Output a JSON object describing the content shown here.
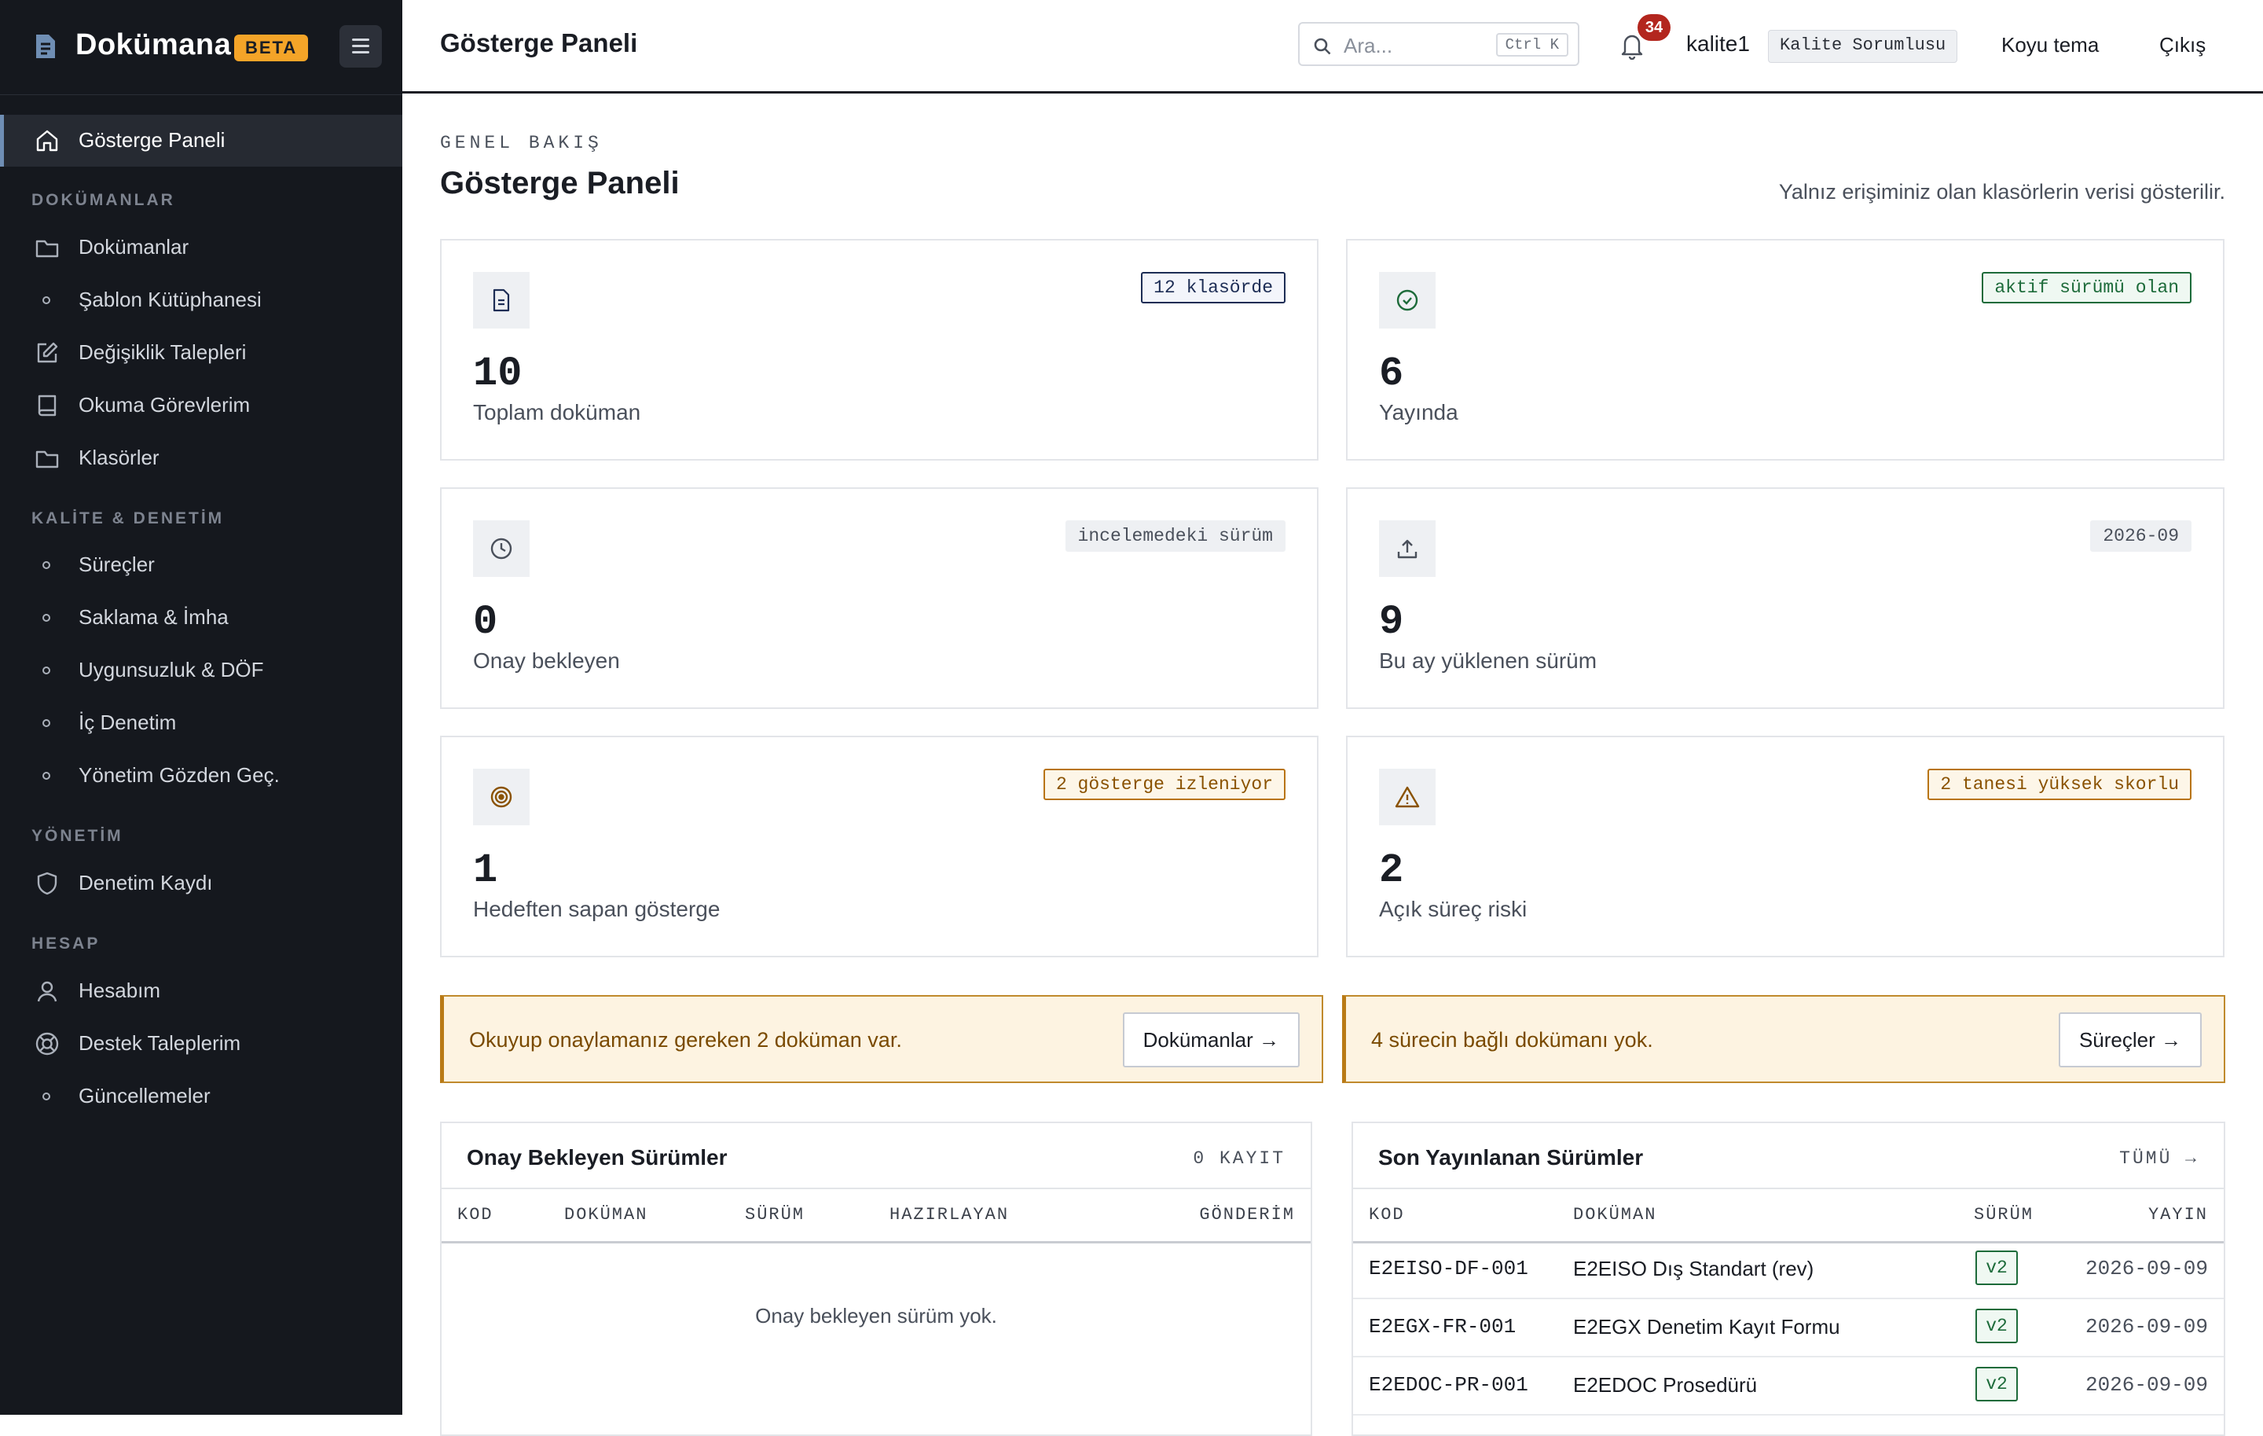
{
  "brand": {
    "name": "Dokümana",
    "badge": "BETA"
  },
  "topbar": {
    "title": "Gösterge Paneli",
    "search_placeholder": "Ara...",
    "search_shortcut": "Ctrl K",
    "notification_count": "34",
    "username": "kalite1",
    "role": "Kalite Sorumlusu",
    "theme_toggle": "Koyu tema",
    "logout": "Çıkış"
  },
  "sidebar": {
    "dashboard": "Gösterge Paneli",
    "sections": {
      "documents": "DOKÜMANLAR",
      "quality": "KALİTE & DENETİM",
      "admin": "YÖNETİM",
      "account": "HESAP"
    },
    "items": {
      "documents": "Dokümanlar",
      "templates": "Şablon Kütüphanesi",
      "change_requests": "Değişiklik Talepleri",
      "reading_tasks": "Okuma Görevlerim",
      "folders": "Klasörler",
      "processes": "Süreçler",
      "retention": "Saklama & İmha",
      "nonconformity": "Uygunsuzluk & DÖF",
      "internal_audit": "İç Denetim",
      "management_review": "Yönetim Gözden Geç.",
      "audit_log": "Denetim Kaydı",
      "my_account": "Hesabım",
      "support": "Destek Taleplerim",
      "updates": "Güncellemeler"
    }
  },
  "main": {
    "eyebrow": "GENEL BAKIŞ",
    "title": "Gösterge Paneli",
    "note": "Yalnız erişiminiz olan klasörlerin verisi gösterilir."
  },
  "cards": {
    "total_docs": {
      "value": "10",
      "label": "Toplam doküman",
      "tag": "12 klasörde"
    },
    "published": {
      "value": "6",
      "label": "Yayında",
      "tag": "aktif sürümü olan"
    },
    "pending": {
      "value": "0",
      "label": "Onay bekleyen",
      "tag": "incelemedeki sürüm"
    },
    "uploaded": {
      "value": "9",
      "label": "Bu ay yüklenen sürüm",
      "tag": "2026-09"
    },
    "off_target": {
      "value": "1",
      "label": "Hedeften sapan gösterge",
      "tag": "2 gösterge izleniyor"
    },
    "risks": {
      "value": "2",
      "label": "Açık süreç riski",
      "tag": "2 tanesi yüksek skorlu"
    }
  },
  "alerts": {
    "reading": {
      "text": "Okuyup onaylamanız gereken 2 doküman var.",
      "button": "Dokümanlar →"
    },
    "processes": {
      "text": "4 sürecin bağlı dokümanı yok.",
      "button": "Süreçler →"
    }
  },
  "pending_panel": {
    "title": "Onay Bekleyen Sürümler",
    "meta": "0 KAYIT",
    "columns": [
      "KOD",
      "DOKÜMAN",
      "SÜRÜM",
      "HAZIRLAYAN",
      "GÖNDERİM"
    ],
    "empty": "Onay bekleyen sürüm yok."
  },
  "published_panel": {
    "title": "Son Yayınlanan Sürümler",
    "link": "TÜMÜ →",
    "columns": [
      "KOD",
      "DOKÜMAN",
      "SÜRÜM",
      "YAYIN"
    ],
    "rows": [
      {
        "code": "E2EISO-DF-001",
        "name": "E2EISO Dış Standart (rev)",
        "version": "v2",
        "date": "2026-09-09"
      },
      {
        "code": "E2EGX-FR-001",
        "name": "E2EGX Denetim Kayıt Formu",
        "version": "v2",
        "date": "2026-09-09"
      },
      {
        "code": "E2EDOC-PR-001",
        "name": "E2EDOC Prosedürü",
        "version": "v2",
        "date": "2026-09-09"
      }
    ]
  },
  "colors": {
    "sidebar_bg": "#15181e",
    "accent_amber": "#f4a428",
    "badge_red": "#b3261e",
    "status_green": "#1d6b3a",
    "tag_navy": "#1d2d55",
    "alert_bg": "#fdf3e1"
  }
}
